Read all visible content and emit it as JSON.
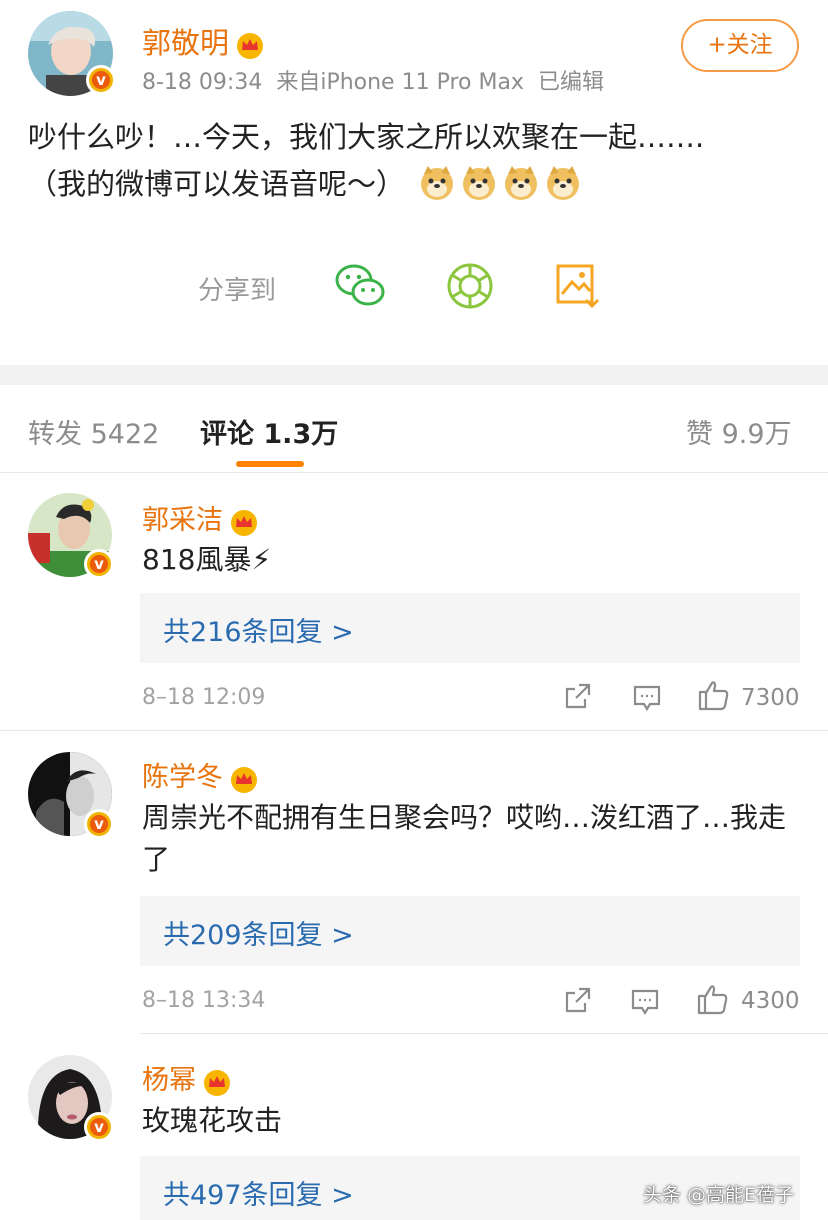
{
  "post": {
    "author": "郭敬明",
    "time": "8-18 09:34",
    "source": "来自iPhone 11 Pro Max",
    "edited": "已编辑",
    "follow_label": "+关注",
    "content_line1": "吵什么吵！…今天，我们大家之所以欢聚在一起…….",
    "content_line2": "（我的微博可以发语音呢～）",
    "share_label": "分享到",
    "share_icons": [
      "wechat-icon",
      "moments-icon",
      "save-image-icon"
    ]
  },
  "tabs": {
    "repost": "转发 5422",
    "comments": "评论 1.3万",
    "likes": "赞 9.9万"
  },
  "comments": [
    {
      "name": "郭采洁",
      "text": "818風暴⚡",
      "replies": "共216条回复 >",
      "time": "8–18 12:09",
      "likes": "7300"
    },
    {
      "name": "陈学冬",
      "text": "周崇光不配拥有生日聚会吗？哎哟…泼红酒了…我走了",
      "replies": "共209条回复 >",
      "time": "8–18 13:34",
      "likes": "4300"
    },
    {
      "name": "杨幂",
      "text": "玫瑰花攻击",
      "replies": "共497条回复 >"
    }
  ],
  "colors": {
    "accent_orange": "#e8740f",
    "link_blue": "#2a6bb0",
    "tab_underline": "#ff8200"
  },
  "watermark": "头条 @高能E蓓子"
}
